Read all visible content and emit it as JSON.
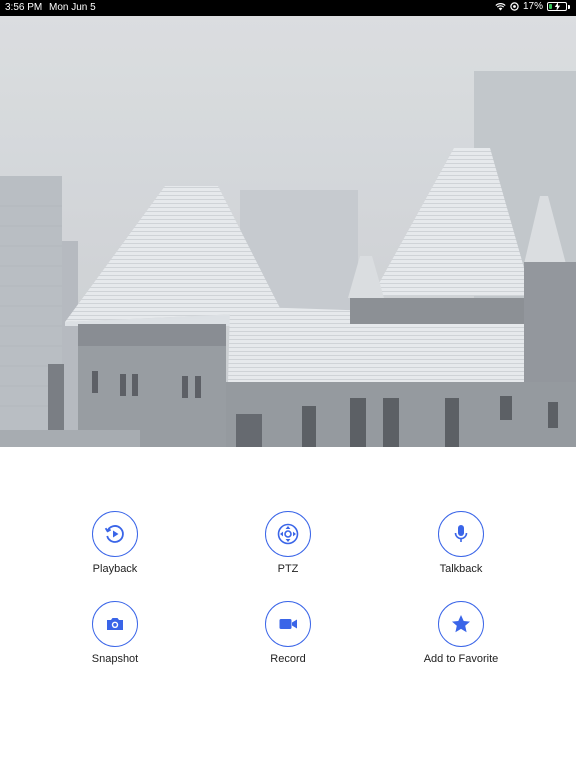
{
  "status_bar": {
    "time": "3:56 PM",
    "date": "Mon Jun 5",
    "battery_percent": "17%",
    "battery_level": 0.17,
    "icons": [
      "wifi-icon",
      "location-lock-icon",
      "battery-charging-icon"
    ]
  },
  "video": {
    "description_icon": "live-camera-feed"
  },
  "actions": [
    {
      "label": "Playback",
      "icon": "playback-icon"
    },
    {
      "label": "PTZ",
      "icon": "ptz-icon"
    },
    {
      "label": "Talkback",
      "icon": "microphone-icon"
    },
    {
      "label": "Snapshot",
      "icon": "camera-icon"
    },
    {
      "label": "Record",
      "icon": "video-camera-icon"
    },
    {
      "label": "Add to Favorite",
      "icon": "star-icon"
    }
  ],
  "colors": {
    "accent": "#3a65e8",
    "status_bar_bg": "#000000",
    "battery_green": "#34c759"
  }
}
